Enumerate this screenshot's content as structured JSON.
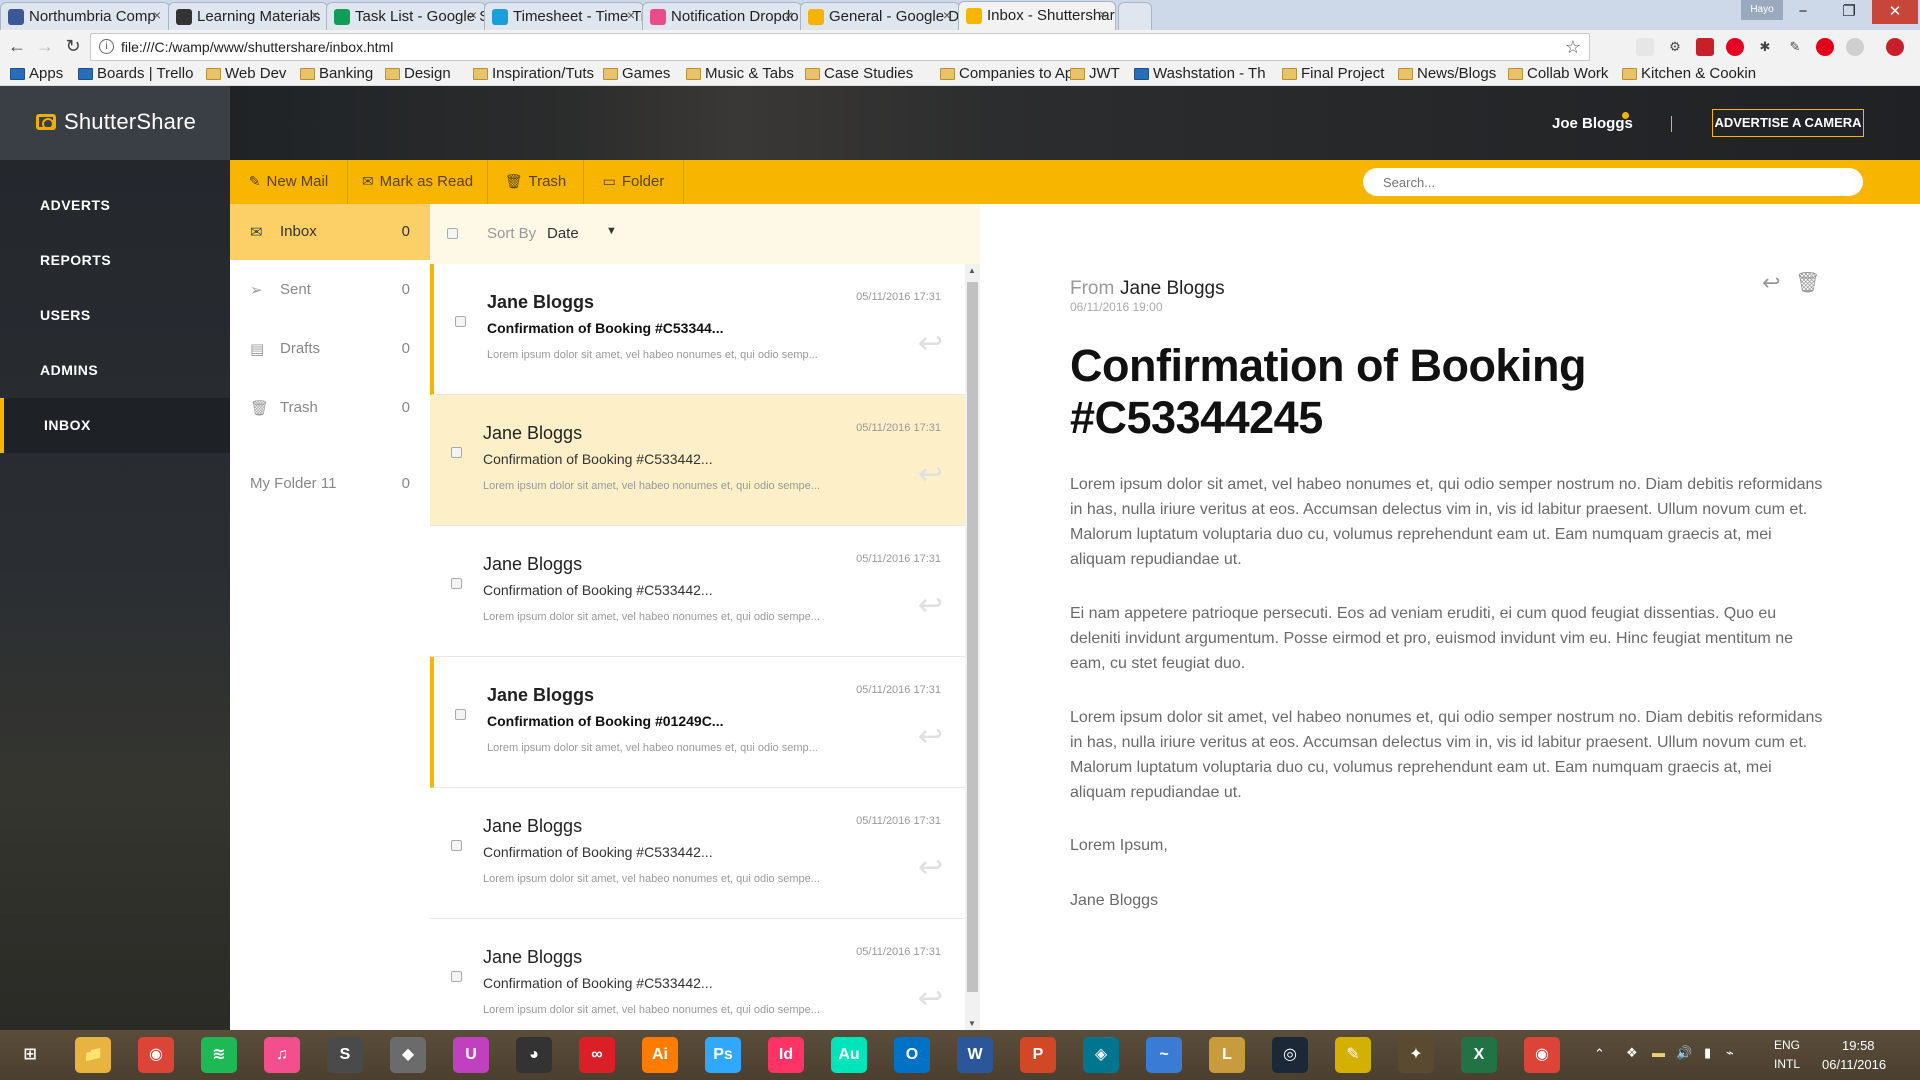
{
  "browser": {
    "tabs": [
      {
        "label": "Northumbria Comp",
        "color": "#3b5998",
        "active": false
      },
      {
        "label": "Learning Materials",
        "color": "#333333",
        "active": false
      },
      {
        "label": "Task List - Google S",
        "color": "#0f9d58",
        "active": false
      },
      {
        "label": "Timesheet - Time Tr",
        "color": "#1a9fdb",
        "active": false
      },
      {
        "label": "Notification Dropdo",
        "color": "#ea4c89",
        "active": false
      },
      {
        "label": "General - Google Dr",
        "color": "#f4b400",
        "active": false
      },
      {
        "label": "Inbox - Shuttershare",
        "color": "#f7b500",
        "active": true
      }
    ],
    "user_chip": "Hayo",
    "window_controls": {
      "minimize": "−",
      "maximize": "❐",
      "close": "✕"
    },
    "nav": {
      "back": "←",
      "forward": "→",
      "reload": "↻"
    },
    "url": "file:///C:/wamp/www/shuttershare/inbox.html",
    "bookmarks": [
      {
        "label": "Apps",
        "folder": false
      },
      {
        "label": "Boards | Trello",
        "folder": false
      },
      {
        "label": "Web Dev",
        "folder": true
      },
      {
        "label": "Banking",
        "folder": true
      },
      {
        "label": "Design",
        "folder": true
      },
      {
        "label": "Inspiration/Tuts",
        "folder": true
      },
      {
        "label": "Games",
        "folder": true
      },
      {
        "label": "Music & Tabs",
        "folder": true
      },
      {
        "label": "Case Studies",
        "folder": true
      },
      {
        "label": "Companies to Ap",
        "folder": true
      },
      {
        "label": "JWT",
        "folder": true
      },
      {
        "label": "Washstation - Th",
        "folder": false
      },
      {
        "label": "Final Project",
        "folder": true
      },
      {
        "label": "News/Blogs",
        "folder": true
      },
      {
        "label": "Collab Work",
        "folder": true
      },
      {
        "label": "Kitchen & Cookin",
        "folder": true
      }
    ]
  },
  "app": {
    "brand": "ShutterShare",
    "accent": "#f7b500",
    "sidebar": [
      {
        "label": "ADVERTS",
        "active": false
      },
      {
        "label": "REPORTS",
        "active": false
      },
      {
        "label": "USERS",
        "active": false
      },
      {
        "label": "ADMINS",
        "active": false
      },
      {
        "label": "INBOX",
        "active": true
      }
    ],
    "topbar": {
      "user": "Joe Bloggs",
      "advertise": "ADVERTISE A CAMERA"
    },
    "actions": [
      {
        "label": "New Mail",
        "icon": "pencil-icon",
        "glyph": "✎"
      },
      {
        "label": "Mark as Read",
        "icon": "read-icon",
        "glyph": "✉"
      },
      {
        "label": "Trash",
        "icon": "trash-icon",
        "glyph": "🗑"
      },
      {
        "label": "Folder",
        "icon": "folder-icon",
        "glyph": "▭"
      }
    ],
    "search_placeholder": "Search...",
    "folders": [
      {
        "label": "Inbox",
        "count": "0",
        "icon": "inbox-icon",
        "glyph": "✉",
        "active": true
      },
      {
        "label": "Sent",
        "count": "0",
        "icon": "send-icon",
        "glyph": "➢",
        "active": false
      },
      {
        "label": "Drafts",
        "count": "0",
        "icon": "drafts-icon",
        "glyph": "▤",
        "active": false
      },
      {
        "label": "Trash",
        "count": "0",
        "icon": "trash-icon",
        "glyph": "🗑",
        "active": false
      },
      {
        "label": "My Folder 11",
        "count": "0",
        "icon": "",
        "glyph": "",
        "active": false
      }
    ],
    "more_dots": "•••",
    "list_header": {
      "sort_label": "Sort By",
      "sort_value": "Date",
      "caret": "▼"
    },
    "messages": [
      {
        "from": "Jane Bloggs",
        "subject": "Confirmation of Booking #C53344...",
        "preview": "Lorem ipsum dolor sit amet, vel habeo nonumes et, qui odio semp...",
        "date": "05/11/2016 17:31",
        "unread": true,
        "selected": false
      },
      {
        "from": "Jane Bloggs",
        "subject": "Confirmation of Booking #C533442...",
        "preview": "Lorem ipsum dolor sit amet, vel habeo nonumes et, qui odio sempe...",
        "date": "05/11/2016 17:31",
        "unread": false,
        "selected": true
      },
      {
        "from": "Jane Bloggs",
        "subject": "Confirmation of Booking #C533442...",
        "preview": "Lorem ipsum dolor sit amet, vel habeo nonumes et, qui odio sempe...",
        "date": "05/11/2016 17:31",
        "unread": false,
        "selected": false
      },
      {
        "from": "Jane Bloggs",
        "subject": "Confirmation of Booking #01249C...",
        "preview": "Lorem ipsum dolor sit amet, vel habeo nonumes et, qui odio semp...",
        "date": "05/11/2016 17:31",
        "unread": true,
        "selected": false
      },
      {
        "from": "Jane Bloggs",
        "subject": "Confirmation of Booking #C533442...",
        "preview": "Lorem ipsum dolor sit amet, vel habeo nonumes et, qui odio sempe...",
        "date": "05/11/2016 17:31",
        "unread": false,
        "selected": false
      },
      {
        "from": "Jane Bloggs",
        "subject": "Confirmation of Booking #C533442...",
        "preview": "Lorem ipsum dolor sit amet, vel habeo nonumes et, qui odio sempe...",
        "date": "05/11/2016 17:31",
        "unread": false,
        "selected": false
      }
    ],
    "reply_glyph": "↩",
    "reader": {
      "from_label": "From",
      "from": "Jane Bloggs",
      "sent": "06/11/2016 19:00",
      "title": "Confirmation of Booking #C53344245",
      "paragraphs": [
        "Lorem ipsum dolor sit amet, vel habeo nonumes et, qui odio semper nostrum no. Diam debitis reformidans in has, nulla iriure veritus at eos. Accumsan delectus vim in, vis id labitur praesent. Ullum novum cum et. Malorum luptatum voluptaria duo cu, volumus reprehendunt eam ut. Eam numquam graecis at, mei aliquam repudiandae ut.",
        "Ei nam appetere patrioque persecuti. Eos ad veniam eruditi, ei cum quod feugiat dissentias. Quo eu deleniti invidunt argumentum. Posse eirmod et pro, euismod invidunt vim eu. Hinc feugiat mentitum ne eam, cu stet feugiat duo.",
        "Lorem ipsum dolor sit amet, vel habeo nonumes et, qui odio semper nostrum no. Diam debitis reformidans in has, nulla iriure veritus at eos. Accumsan delectus vim in, vis id labitur praesent. Ullum novum cum et. Malorum luptatum voluptaria duo cu, volumus reprehendunt eam ut. Eam numquam graecis at, mei aliquam repudiandae ut.",
        "Lorem Ipsum,",
        "Jane Bloggs"
      ],
      "reply_glyph": "↩",
      "delete_glyph": "🗑"
    }
  },
  "taskbar": {
    "apps": [
      {
        "icon": "windows-start-icon",
        "label": "⊞",
        "color": "transparent"
      },
      {
        "icon": "file-explorer-icon",
        "label": "📁",
        "color": "#e8b440"
      },
      {
        "icon": "chrome-icon",
        "label": "◉",
        "color": "#db4437"
      },
      {
        "icon": "spotify-icon",
        "label": "≋",
        "color": "#1db954"
      },
      {
        "icon": "itunes-icon",
        "label": "♫",
        "color": "#f24f8c"
      },
      {
        "icon": "sublime-icon",
        "label": "S",
        "color": "#4a4a4a"
      },
      {
        "icon": "inkscape-icon",
        "label": "◆",
        "color": "#6b6b6b"
      },
      {
        "icon": "uplay-icon",
        "label": "U",
        "color": "#c040c0"
      },
      {
        "icon": "github-icon",
        "label": "◕",
        "color": "#333333"
      },
      {
        "icon": "creative-cloud-icon",
        "label": "∞",
        "color": "#da1f26"
      },
      {
        "icon": "illustrator-icon",
        "label": "Ai",
        "color": "#ff7c00"
      },
      {
        "icon": "photoshop-icon",
        "label": "Ps",
        "color": "#31a8ff"
      },
      {
        "icon": "indesign-icon",
        "label": "Id",
        "color": "#ff3366"
      },
      {
        "icon": "audition-icon",
        "label": "Au",
        "color": "#00e4bb"
      },
      {
        "icon": "outlook-icon",
        "label": "O",
        "color": "#0072c6"
      },
      {
        "icon": "word-icon",
        "label": "W",
        "color": "#2b579a"
      },
      {
        "icon": "powerpoint-icon",
        "label": "P",
        "color": "#d24726"
      },
      {
        "icon": "mysql-icon",
        "label": "◈",
        "color": "#00758f"
      },
      {
        "icon": "dolphin-icon",
        "label": "~",
        "color": "#3a7bd5"
      },
      {
        "icon": "league-icon",
        "label": "L",
        "color": "#c89b3c"
      },
      {
        "icon": "steam-icon",
        "label": "◎",
        "color": "#1b2838"
      },
      {
        "icon": "notes-icon",
        "label": "✎",
        "color": "#d4b000"
      },
      {
        "icon": "game-icon",
        "label": "✦",
        "color": "#5a4a30"
      },
      {
        "icon": "excel-icon",
        "label": "X",
        "color": "#217346"
      },
      {
        "icon": "chrome-icon-2",
        "label": "◉",
        "color": "#db4437"
      }
    ],
    "lang": "ENG",
    "region": "INTL",
    "time": "19:58",
    "date": "06/11/2016"
  }
}
